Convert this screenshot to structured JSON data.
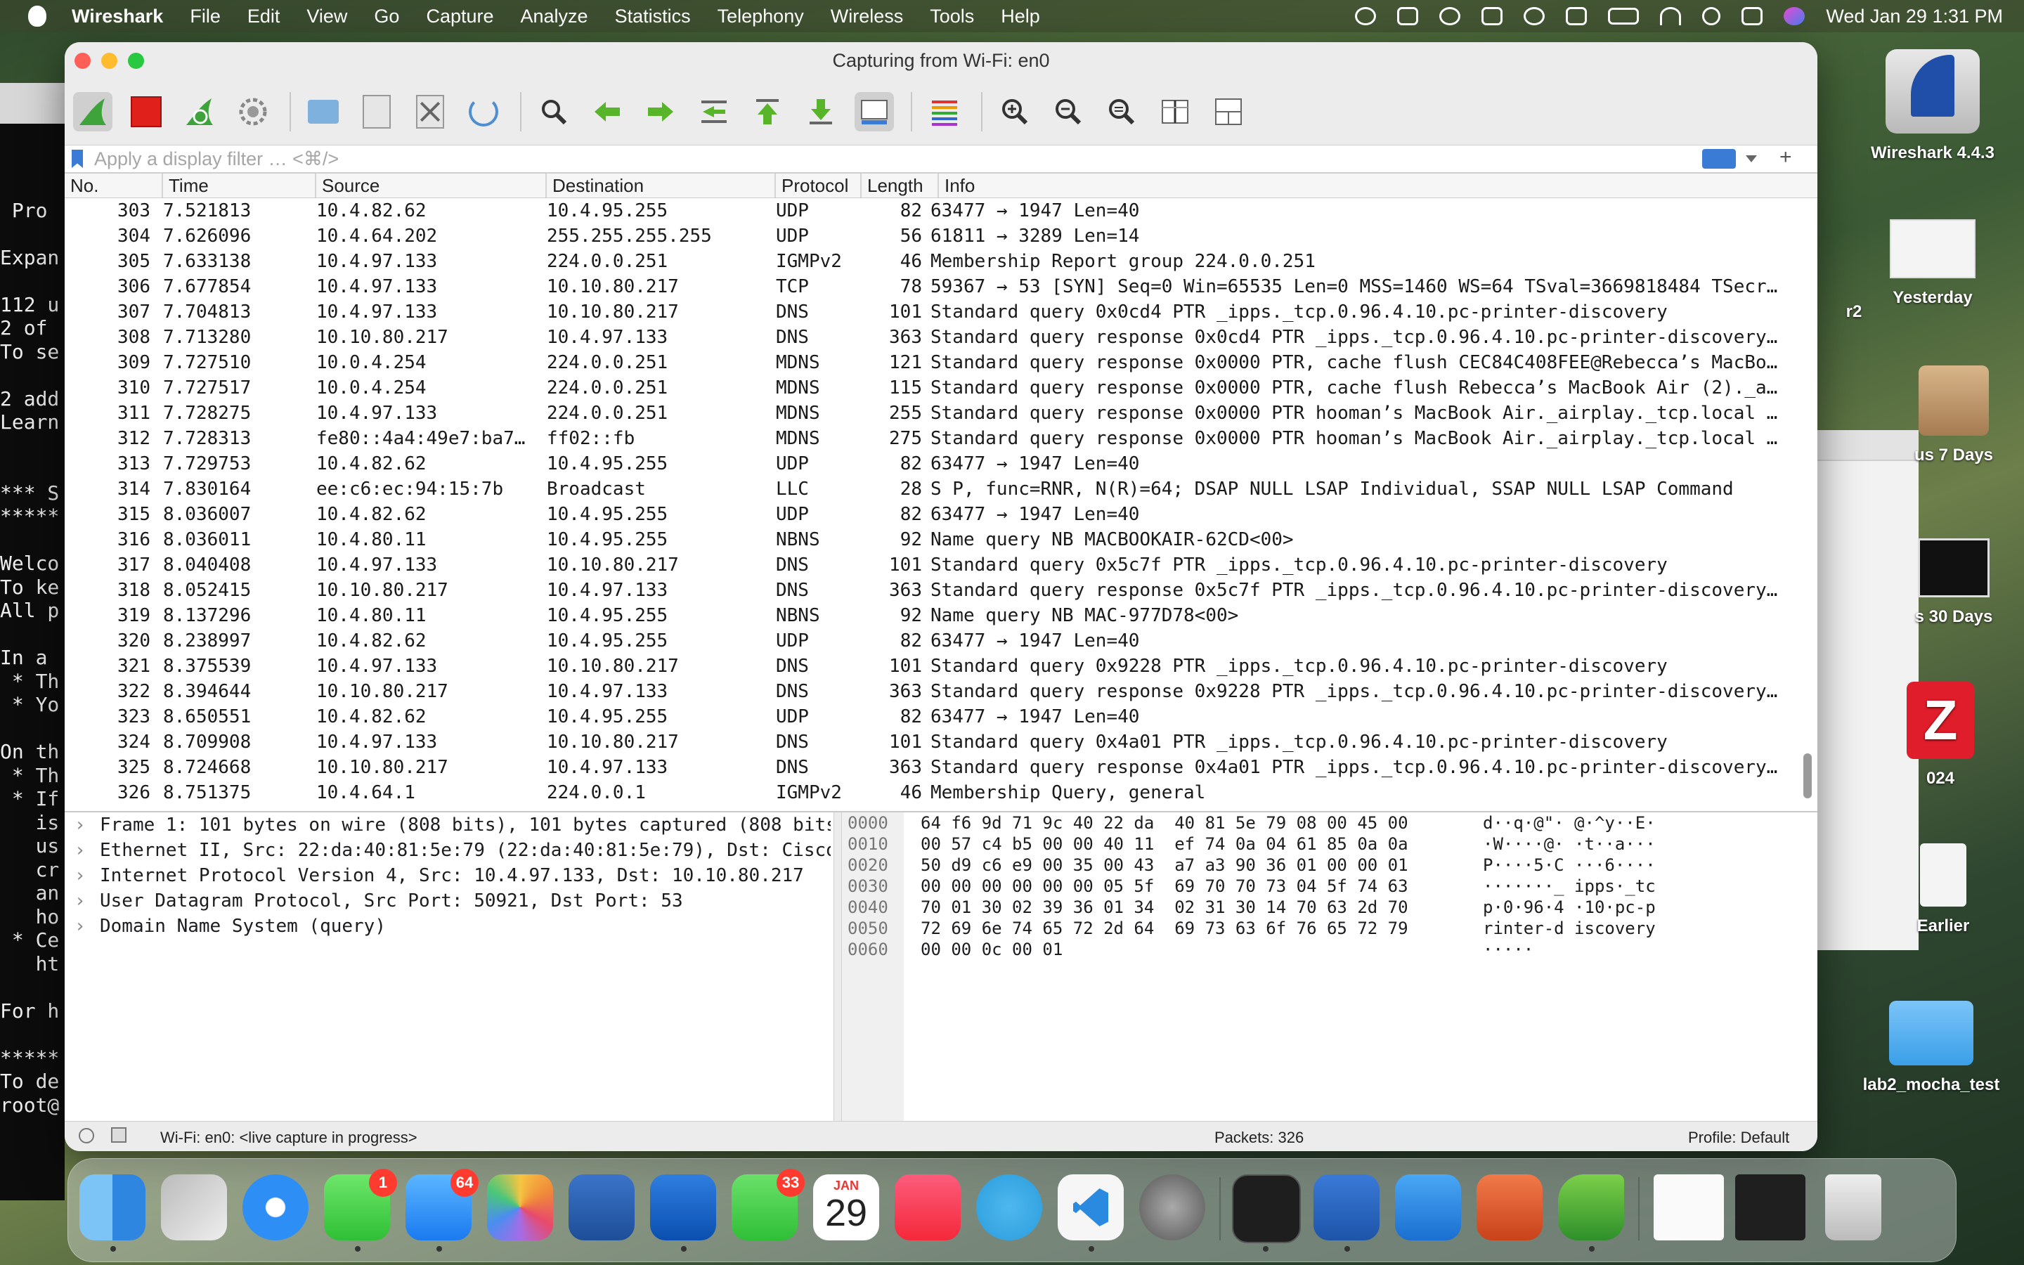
{
  "menubar": {
    "app_name": "Wireshark",
    "items": [
      "File",
      "Edit",
      "View",
      "Go",
      "Capture",
      "Analyze",
      "Statistics",
      "Telephony",
      "Wireless",
      "Tools",
      "Help"
    ],
    "clock": "Wed Jan 29  1:31 PM"
  },
  "terminal_lines": [
    " Pro",
    "",
    "Expan",
    "",
    "112 u",
    "2 of",
    "To se",
    "",
    "2 add",
    "Learn",
    "",
    "",
    "*** S",
    "*****",
    "",
    "Welco",
    "To ke",
    "All p",
    "",
    "In a",
    " * Th",
    " * Yo",
    "",
    "On th",
    " * Th",
    " * If",
    "   is",
    "   us",
    "   cr",
    "   an",
    "   ho",
    " * Ce",
    "   ht",
    "",
    "For h",
    "",
    "*****",
    "To de",
    "root@"
  ],
  "desktop": {
    "icons": [
      {
        "label": "Wireshark 4.4.3"
      },
      {
        "label": "Yesterday"
      },
      {
        "label": "r2"
      },
      {
        "label": "us 7 Days"
      },
      {
        "label": "s 30 Days"
      },
      {
        "label": "024"
      },
      {
        "label": "Earlier"
      },
      {
        "label": "lab2_mocha_test"
      }
    ]
  },
  "window": {
    "title": "Capturing from Wi-Fi: en0",
    "filter_placeholder": "Apply a display filter … <⌘/>",
    "columns": [
      "No.",
      "Time",
      "Source",
      "Destination",
      "Protocol",
      "Length",
      "Info"
    ],
    "packets": [
      {
        "no": "303",
        "time": "7.521813",
        "src": "10.4.82.62",
        "dst": "10.4.95.255",
        "proto": "UDP",
        "len": "82",
        "info": "63477 → 1947 Len=40"
      },
      {
        "no": "304",
        "time": "7.626096",
        "src": "10.4.64.202",
        "dst": "255.255.255.255",
        "proto": "UDP",
        "len": "56",
        "info": "61811 → 3289 Len=14"
      },
      {
        "no": "305",
        "time": "7.633138",
        "src": "10.4.97.133",
        "dst": "224.0.0.251",
        "proto": "IGMPv2",
        "len": "46",
        "info": "Membership Report group 224.0.0.251"
      },
      {
        "no": "306",
        "time": "7.677854",
        "src": "10.4.97.133",
        "dst": "10.10.80.217",
        "proto": "TCP",
        "len": "78",
        "info": "59367 → 53 [SYN] Seq=0 Win=65535 Len=0 MSS=1460 WS=64 TSval=3669818484 TSecr…"
      },
      {
        "no": "307",
        "time": "7.704813",
        "src": "10.4.97.133",
        "dst": "10.10.80.217",
        "proto": "DNS",
        "len": "101",
        "info": "Standard query 0x0cd4 PTR _ipps._tcp.0.96.4.10.pc-printer-discovery"
      },
      {
        "no": "308",
        "time": "7.713280",
        "src": "10.10.80.217",
        "dst": "10.4.97.133",
        "proto": "DNS",
        "len": "363",
        "info": "Standard query response 0x0cd4 PTR _ipps._tcp.0.96.4.10.pc-printer-discovery…"
      },
      {
        "no": "309",
        "time": "7.727510",
        "src": "10.0.4.254",
        "dst": "224.0.0.251",
        "proto": "MDNS",
        "len": "121",
        "info": "Standard query response 0x0000 PTR, cache flush CEC84C408FEE@Rebecca’s MacBo…"
      },
      {
        "no": "310",
        "time": "7.727517",
        "src": "10.0.4.254",
        "dst": "224.0.0.251",
        "proto": "MDNS",
        "len": "115",
        "info": "Standard query response 0x0000 PTR, cache flush Rebecca’s MacBook Air (2)._a…"
      },
      {
        "no": "311",
        "time": "7.728275",
        "src": "10.4.97.133",
        "dst": "224.0.0.251",
        "proto": "MDNS",
        "len": "255",
        "info": "Standard query response 0x0000 PTR hooman’s MacBook Air._airplay._tcp.local …"
      },
      {
        "no": "312",
        "time": "7.728313",
        "src": "fe80::4a4:49e7:ba7…",
        "dst": "ff02::fb",
        "proto": "MDNS",
        "len": "275",
        "info": "Standard query response 0x0000 PTR hooman’s MacBook Air._airplay._tcp.local …"
      },
      {
        "no": "313",
        "time": "7.729753",
        "src": "10.4.82.62",
        "dst": "10.4.95.255",
        "proto": "UDP",
        "len": "82",
        "info": "63477 → 1947 Len=40"
      },
      {
        "no": "314",
        "time": "7.830164",
        "src": "ee:c6:ec:94:15:7b",
        "dst": "Broadcast",
        "proto": "LLC",
        "len": "28",
        "info": "S P, func=RNR, N(R)=64; DSAP NULL LSAP Individual, SSAP NULL LSAP Command"
      },
      {
        "no": "315",
        "time": "8.036007",
        "src": "10.4.82.62",
        "dst": "10.4.95.255",
        "proto": "UDP",
        "len": "82",
        "info": "63477 → 1947 Len=40"
      },
      {
        "no": "316",
        "time": "8.036011",
        "src": "10.4.80.11",
        "dst": "10.4.95.255",
        "proto": "NBNS",
        "len": "92",
        "info": "Name query NB MACBOOKAIR-62CD<00>"
      },
      {
        "no": "317",
        "time": "8.040408",
        "src": "10.4.97.133",
        "dst": "10.10.80.217",
        "proto": "DNS",
        "len": "101",
        "info": "Standard query 0x5c7f PTR _ipps._tcp.0.96.4.10.pc-printer-discovery"
      },
      {
        "no": "318",
        "time": "8.052415",
        "src": "10.10.80.217",
        "dst": "10.4.97.133",
        "proto": "DNS",
        "len": "363",
        "info": "Standard query response 0x5c7f PTR _ipps._tcp.0.96.4.10.pc-printer-discovery…"
      },
      {
        "no": "319",
        "time": "8.137296",
        "src": "10.4.80.11",
        "dst": "10.4.95.255",
        "proto": "NBNS",
        "len": "92",
        "info": "Name query NB MAC-977D78<00>"
      },
      {
        "no": "320",
        "time": "8.238997",
        "src": "10.4.82.62",
        "dst": "10.4.95.255",
        "proto": "UDP",
        "len": "82",
        "info": "63477 → 1947 Len=40"
      },
      {
        "no": "321",
        "time": "8.375539",
        "src": "10.4.97.133",
        "dst": "10.10.80.217",
        "proto": "DNS",
        "len": "101",
        "info": "Standard query 0x9228 PTR _ipps._tcp.0.96.4.10.pc-printer-discovery"
      },
      {
        "no": "322",
        "time": "8.394644",
        "src": "10.10.80.217",
        "dst": "10.4.97.133",
        "proto": "DNS",
        "len": "363",
        "info": "Standard query response 0x9228 PTR _ipps._tcp.0.96.4.10.pc-printer-discovery…"
      },
      {
        "no": "323",
        "time": "8.650551",
        "src": "10.4.82.62",
        "dst": "10.4.95.255",
        "proto": "UDP",
        "len": "82",
        "info": "63477 → 1947 Len=40"
      },
      {
        "no": "324",
        "time": "8.709908",
        "src": "10.4.97.133",
        "dst": "10.10.80.217",
        "proto": "DNS",
        "len": "101",
        "info": "Standard query 0x4a01 PTR _ipps._tcp.0.96.4.10.pc-printer-discovery"
      },
      {
        "no": "325",
        "time": "8.724668",
        "src": "10.10.80.217",
        "dst": "10.4.97.133",
        "proto": "DNS",
        "len": "363",
        "info": "Standard query response 0x4a01 PTR _ipps._tcp.0.96.4.10.pc-printer-discovery…"
      },
      {
        "no": "326",
        "time": "8.751375",
        "src": "10.4.64.1",
        "dst": "224.0.0.1",
        "proto": "IGMPv2",
        "len": "46",
        "info": "Membership Query, general"
      }
    ],
    "details": [
      "Frame 1: 101 bytes on wire (808 bits), 101 bytes captured (808 bits",
      "Ethernet II, Src: 22:da:40:81:5e:79 (22:da:40:81:5e:79), Dst: Cisco",
      "Internet Protocol Version 4, Src: 10.4.97.133, Dst: 10.10.80.217",
      "User Datagram Protocol, Src Port: 50921, Dst Port: 53",
      "Domain Name System (query)"
    ],
    "hex": [
      {
        "off": "0000",
        "bytes": "64 f6 9d 71 9c 40 22 da  40 81 5e 79 08 00 45 00",
        "ascii": "d··q·@\"· @·^y··E·"
      },
      {
        "off": "0010",
        "bytes": "00 57 c4 b5 00 00 40 11  ef 74 0a 04 61 85 0a 0a",
        "ascii": "·W····@· ·t··a···"
      },
      {
        "off": "0020",
        "bytes": "50 d9 c6 e9 00 35 00 43  a7 a3 90 36 01 00 00 01",
        "ascii": "P····5·C ···6····"
      },
      {
        "off": "0030",
        "bytes": "00 00 00 00 00 00 05 5f  69 70 70 73 04 5f 74 63",
        "ascii": "·······_ ipps·_tc"
      },
      {
        "off": "0040",
        "bytes": "70 01 30 02 39 36 01 34  02 31 30 14 70 63 2d 70",
        "ascii": "p·0·96·4 ·10·pc-p"
      },
      {
        "off": "0050",
        "bytes": "72 69 6e 74 65 72 2d 64  69 73 63 6f 76 65 72 79",
        "ascii": "rinter-d iscovery"
      },
      {
        "off": "0060",
        "bytes": "00 00 0c 00 01",
        "ascii": "·····"
      }
    ],
    "status": {
      "interface": "Wi-Fi: en0: <live capture in progress>",
      "packets": "Packets: 326",
      "profile": "Profile: Default"
    }
  },
  "dock": {
    "badges": {
      "messages": "1",
      "mail": "64",
      "facetime": "33"
    },
    "calendar": {
      "month": "JAN",
      "day": "29"
    }
  },
  "colors": {
    "accent_blue": "#2f7cf6",
    "capture_green": "#3da33a",
    "stop_red": "#e0201b"
  }
}
